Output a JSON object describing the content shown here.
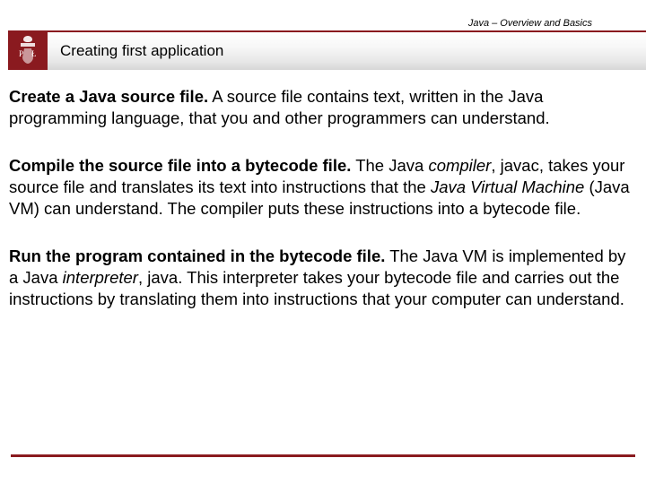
{
  "header": {
    "breadcrumb": "Java – Overview and Basics",
    "title": "Creating first application"
  },
  "logo": {
    "semantic": "university-crest"
  },
  "paragraphs": {
    "p1": {
      "lead": "Create a Java source file.",
      "rest": " A source file contains text, written in the Java programming language, that you and other programmers can understand."
    },
    "p2": {
      "lead": "Compile the source file into a bytecode file.",
      "a": " The Java ",
      "compiler": "compiler",
      "b": ", javac, takes your source file and translates its text into instructions that the ",
      "jvm": "Java Virtual Machine",
      "c": " (Java VM) can understand. The compiler puts these instructions into a bytecode file."
    },
    "p3": {
      "lead": "Run the program contained in the bytecode file.",
      "a": " The Java VM is implemented by a Java ",
      "interp": "interpreter",
      "b": ", java. This interpreter takes your bytecode file and carries out the instructions by translating them into instructions that your computer can understand."
    }
  },
  "colors": {
    "accent": "#8a1a1f"
  }
}
